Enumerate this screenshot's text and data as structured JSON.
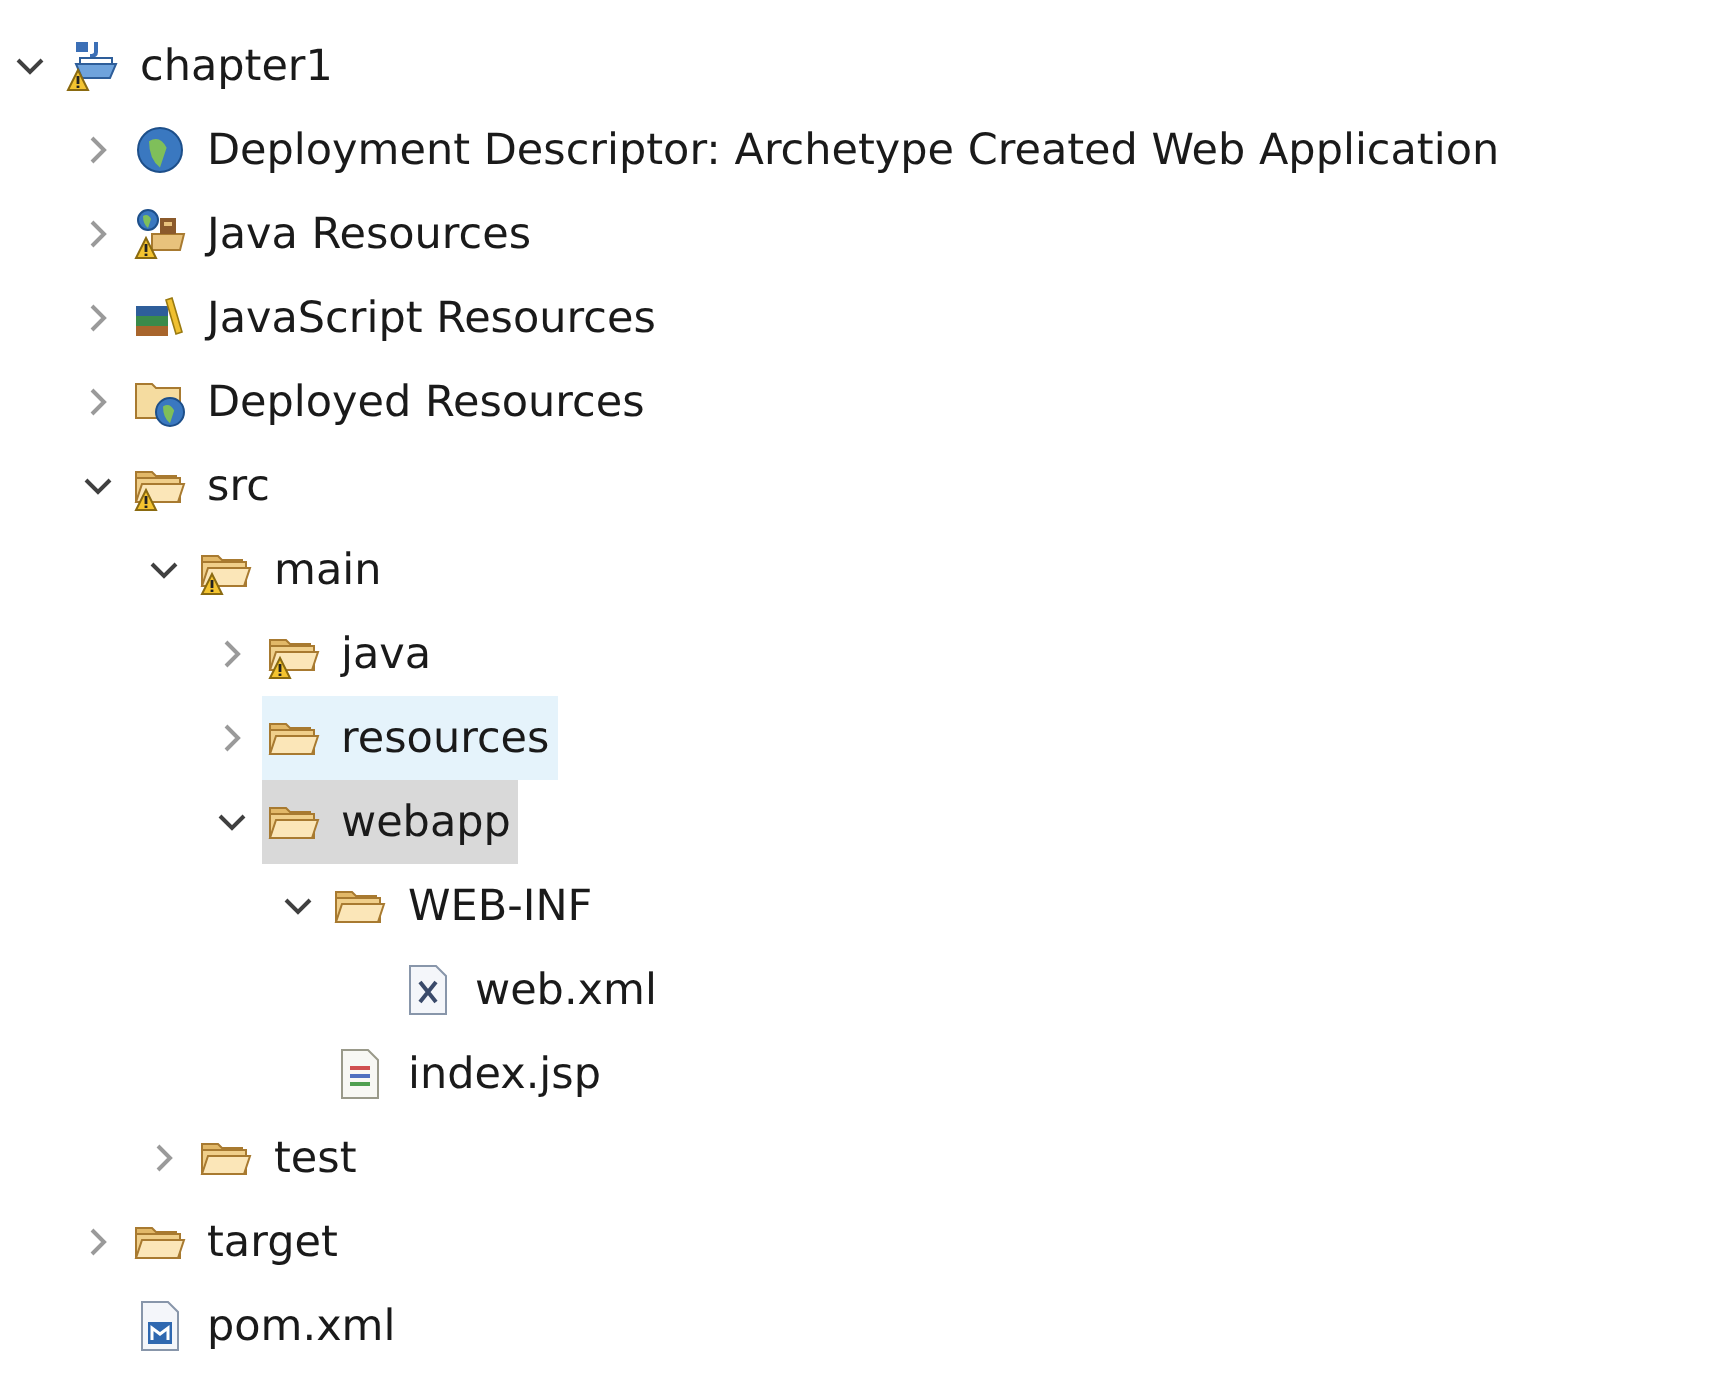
{
  "tree": [
    {
      "label": "chapter1",
      "kind": "project",
      "expanded": true,
      "selected": false,
      "hovered": false,
      "children": [
        {
          "label": "Deployment Descriptor: Archetype Created Web Application",
          "kind": "descriptor",
          "expanded": false,
          "selected": false,
          "hovered": false
        },
        {
          "label": "Java Resources",
          "kind": "java-resources",
          "expanded": false,
          "selected": false,
          "hovered": false
        },
        {
          "label": "JavaScript Resources",
          "kind": "js-resources",
          "expanded": false,
          "selected": false,
          "hovered": false
        },
        {
          "label": "Deployed Resources",
          "kind": "deployed",
          "expanded": false,
          "selected": false,
          "hovered": false
        },
        {
          "label": "src",
          "kind": "warning-folder",
          "expanded": true,
          "selected": false,
          "hovered": false,
          "children": [
            {
              "label": "main",
              "kind": "warning-folder",
              "expanded": true,
              "selected": false,
              "hovered": false,
              "children": [
                {
                  "label": "java",
                  "kind": "warning-folder",
                  "expanded": false,
                  "selected": false,
                  "hovered": false
                },
                {
                  "label": "resources",
                  "kind": "folder",
                  "expanded": false,
                  "selected": false,
                  "hovered": true
                },
                {
                  "label": "webapp",
                  "kind": "folder",
                  "expanded": true,
                  "selected": true,
                  "hovered": false,
                  "children": [
                    {
                      "label": "WEB-INF",
                      "kind": "folder",
                      "expanded": true,
                      "selected": false,
                      "hovered": false,
                      "children": [
                        {
                          "label": "web.xml",
                          "kind": "xml-file",
                          "selected": false,
                          "hovered": false
                        }
                      ]
                    },
                    {
                      "label": "index.jsp",
                      "kind": "jsp-file",
                      "selected": false,
                      "hovered": false
                    }
                  ]
                }
              ]
            },
            {
              "label": "test",
              "kind": "folder",
              "expanded": false,
              "selected": false,
              "hovered": false
            }
          ]
        },
        {
          "label": "target",
          "kind": "folder",
          "expanded": false,
          "selected": false,
          "hovered": false
        },
        {
          "label": "pom.xml",
          "kind": "pom-file",
          "selected": false,
          "hovered": false
        }
      ]
    }
  ]
}
